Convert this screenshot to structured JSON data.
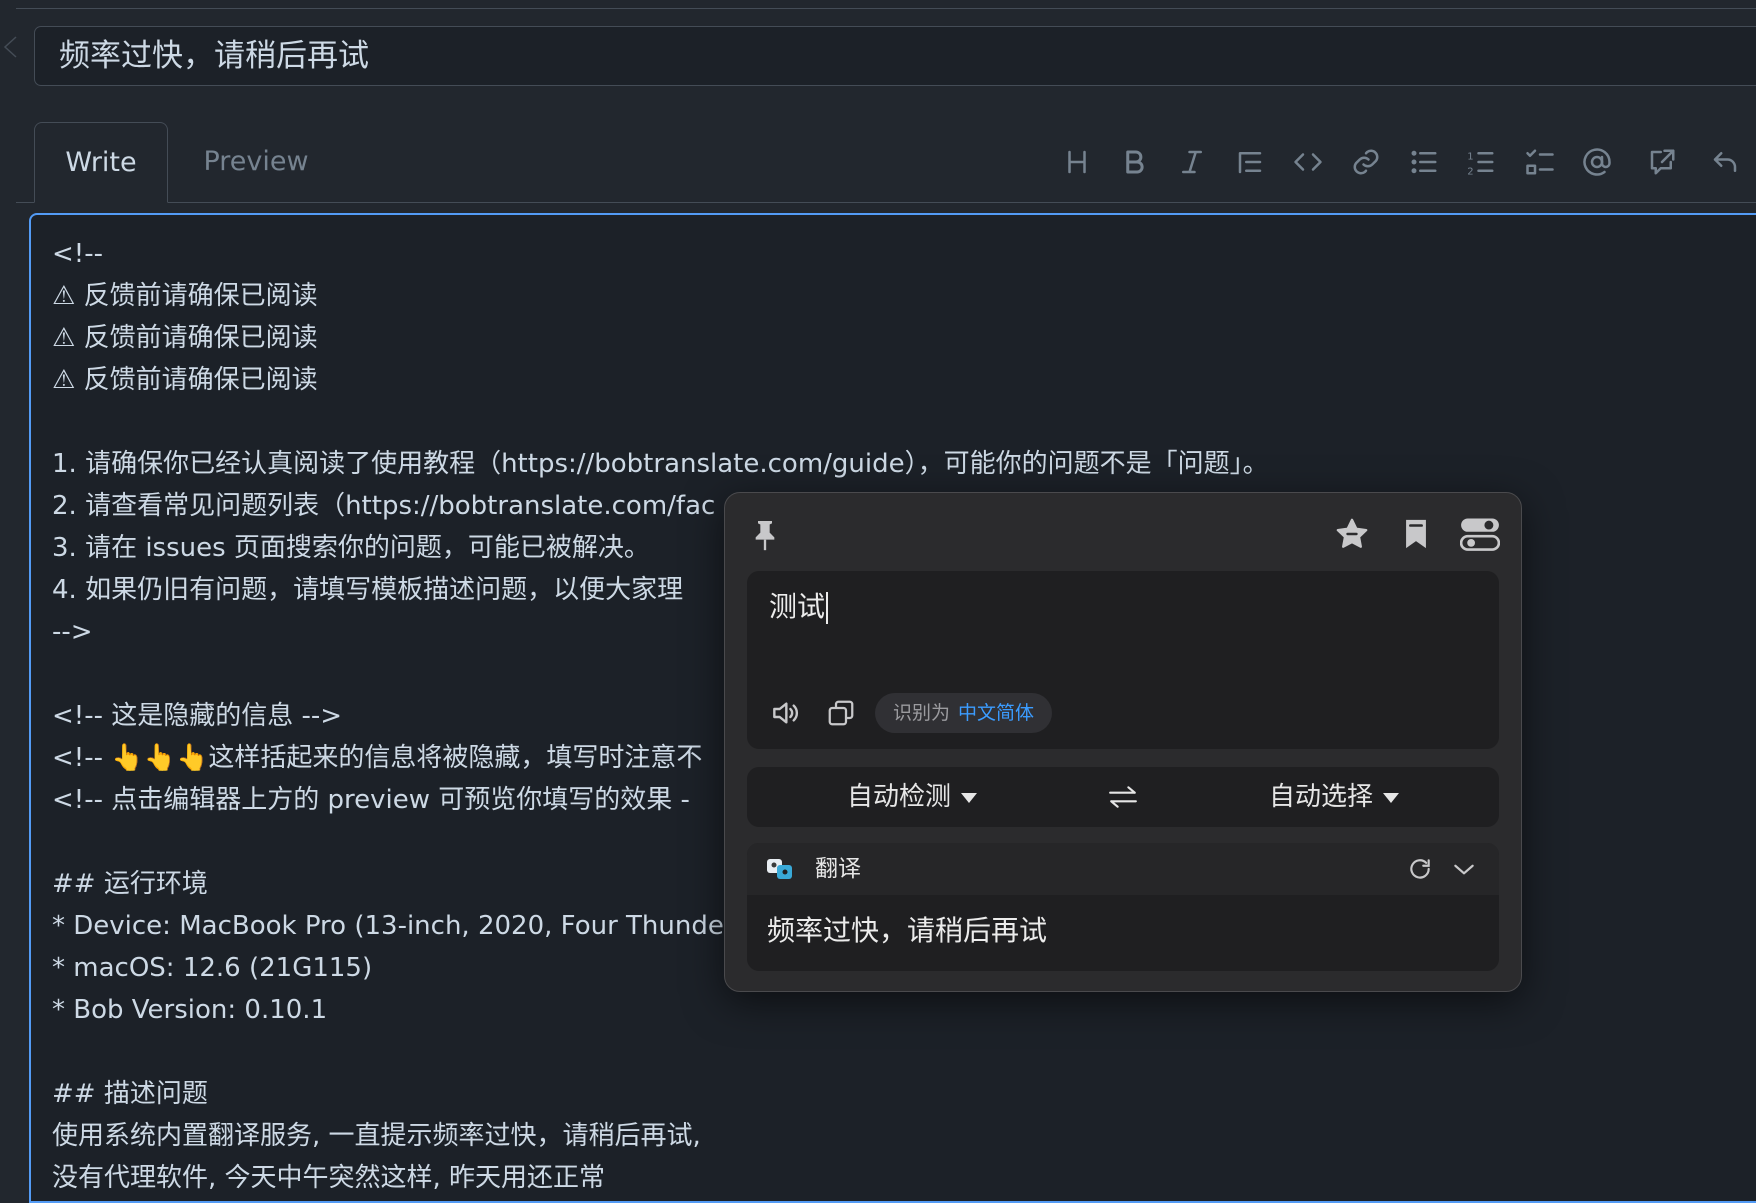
{
  "title_field": {
    "value": "频率过快，请稍后再试"
  },
  "tabs": [
    {
      "label": "Write"
    },
    {
      "label": "Preview"
    }
  ],
  "toolbar": [
    {
      "name": "heading-icon"
    },
    {
      "name": "bold-icon"
    },
    {
      "name": "italic-icon"
    },
    {
      "name": "quote-icon"
    },
    {
      "name": "code-icon"
    },
    {
      "name": "link-icon"
    },
    {
      "name": "bulleted-list-icon"
    },
    {
      "name": "numbered-list-icon"
    },
    {
      "name": "task-list-icon"
    },
    {
      "name": "mention-icon"
    },
    {
      "name": "cross-reference-icon"
    },
    {
      "name": "reply-icon"
    }
  ],
  "editor": {
    "lines": [
      "<!--",
      "⚠ 反馈前请确保已阅读",
      "⚠ 反馈前请确保已阅读",
      "⚠ 反馈前请确保已阅读",
      "",
      "1. 请确保你已经认真阅读了使用教程（https://bobtranslate.com/guide），可能你的问题不是「问题」。",
      "2. 请查看常见问题列表（https://bobtranslate.com/fac",
      "3. 请在 issues 页面搜索你的问题，可能已被解决。",
      "4. 如果仍旧有问题，请填写模板描述问题，以便大家理",
      "-->",
      "",
      "<!-- 这是隐藏的信息 -->",
      "<!-- 👆👆👆这样括起来的信息将被隐藏，填写时注意不",
      "<!-- 点击编辑器上方的 preview 可预览你填写的效果 -",
      "",
      "## 运行环境",
      "* Device: MacBook Pro (13-inch, 2020, Four Thunde",
      "* macOS: 12.6 (21G115)",
      "* Bob Version: 0.10.1",
      "",
      "## 描述问题",
      "使用系统内置翻译服务, 一直提示频率过快，请稍后再试,",
      "没有代理软件, 今天中午突然这样, 昨天用还正常"
    ]
  },
  "popup": {
    "source_text": "测试",
    "detected_prefix": "识别为",
    "detected_language": "中文简体",
    "source_lang": "自动检测",
    "target_lang": "自动选择",
    "service_name": "翻译",
    "result_text": "频率过快，请稍后再试",
    "accent_color": "#3b9cff"
  }
}
